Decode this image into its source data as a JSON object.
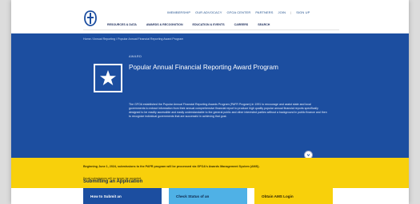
{
  "header": {
    "utility_links": [
      "IMEMBERSHIP",
      "OUR ADVOCACY",
      "GFOA CENTER",
      "PARTNERS",
      "JOIN",
      "SIGN UP"
    ],
    "nav": [
      "RESOURCES & DATA",
      "AWARDS & RECOGNITION",
      "EDUCATION & EVENTS",
      "CAREERS",
      "SEARCH"
    ]
  },
  "hero": {
    "breadcrumb": "Home / Annual Reporting / Popular Annual Financial Reporting Award Program",
    "eyebrow": "AWARD",
    "title": "Popular Annual Financial Reporting Award Program",
    "description": "The GFOA established the Popular Annual Financial Reporting Awards Program (PAFR Program) in 1991 to encourage and assist state and local governments to extract information from their annual comprehensive financial report to produce high quality popular annual financial reports specifically designed to be readily accessible and easily understandable to the general public and other interested parties without a background in public finance and then to recognize individual governments that are successful in achieving that goal."
  },
  "notice": {
    "main": "Beginning June 1, 2024, submissions to the PAFR program will be processed via GFOA's Awards Management System (AMS).",
    "sub": "Email submissions will no longer be accepted."
  },
  "section": {
    "title": "Submitting an Application",
    "cards": [
      "How to Submit an",
      "Check Status of an",
      "Obtain AMS Login"
    ]
  },
  "colors": {
    "hero_blue": "#1c4ea0",
    "notice_yellow": "#f8d00b",
    "card_sky": "#4fb1e6"
  }
}
